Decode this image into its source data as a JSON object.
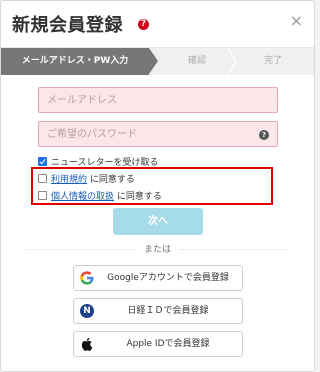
{
  "header": {
    "title": "新規会員登録",
    "help_glyph": "?",
    "close_glyph": "×"
  },
  "steps": [
    {
      "label": "メールアドレス・PW入力",
      "active": true
    },
    {
      "label": "確認",
      "active": false
    },
    {
      "label": "完了",
      "active": false
    }
  ],
  "form": {
    "email_placeholder": "メールアドレス",
    "email_value": "",
    "password_placeholder": "ご希望のパスワード",
    "password_value": "",
    "password_help_glyph": "?"
  },
  "checks": {
    "newsletter_label": "ニュースレターを受け取る",
    "newsletter_checked": true,
    "terms_link": "利用規約",
    "terms_suffix": "に同意する",
    "terms_checked": false,
    "privacy_link": "個人情報の取扱",
    "privacy_suffix": "に同意する",
    "privacy_checked": false
  },
  "next_button_label": "次へ",
  "or_label": "または",
  "sns": [
    {
      "label": "Googleアカウントで会員登録",
      "icon": "google-icon"
    },
    {
      "label": "日経ＩＤで会員登録",
      "icon": "nikkei-icon"
    },
    {
      "label": "Apple IDで会員登録",
      "icon": "apple-icon"
    }
  ],
  "colors": {
    "active_step": "#777777",
    "field_error_bg": "#fbe6e9",
    "field_error_border": "#e6a7b0",
    "next_button": "#a6dce8",
    "highlight_box": "#e00000",
    "link": "#1a5fb4"
  }
}
